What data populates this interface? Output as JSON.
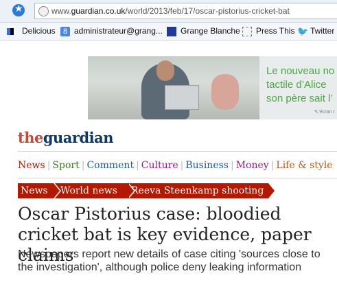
{
  "browser": {
    "url_prefix": "www.",
    "url_domain": "guardian.co.uk",
    "url_path": "/world/2013/feb/17/oscar-pistorius-cricket-bat",
    "bookmarks": [
      {
        "label": "Delicious",
        "icon": "delicious-icon"
      },
      {
        "label": "administrateur@grang...",
        "icon": "google-icon"
      },
      {
        "label": "Grange Blanche",
        "icon": "grange-blanche-icon"
      },
      {
        "label": "Press This",
        "icon": "press-this-icon"
      },
      {
        "label": "Twitter",
        "icon": "twitter-icon"
      }
    ]
  },
  "ad": {
    "line1": "Le nouveau no",
    "line2": "tactile d’Alice",
    "line3": "son père sait l’",
    "fine": "*L'écran t",
    "text_color": "#4aa83f"
  },
  "site": {
    "logo_the": "the",
    "logo_guardian": "guardian"
  },
  "nav": [
    {
      "label": "News",
      "color": "#b51800"
    },
    {
      "label": "Sport",
      "color": "#3d7a1f"
    },
    {
      "label": "Comment",
      "color": "#1f5f8e"
    },
    {
      "label": "Culture",
      "color": "#a1137b"
    },
    {
      "label": "Business",
      "color": "#1c5bab"
    },
    {
      "label": "Money",
      "color": "#8a1f7a"
    },
    {
      "label": "Life & style",
      "color": "#b35c1e"
    }
  ],
  "breadcrumbs": [
    "News",
    "World news",
    "Reeva Steenkamp shooting"
  ],
  "article": {
    "headline": "Oscar Pistorius case: bloodied cricket bat is key evidence, paper claims",
    "standfirst": "Newspapers report new details of case citing 'sources close to the investigation', although police deny leaking information"
  }
}
